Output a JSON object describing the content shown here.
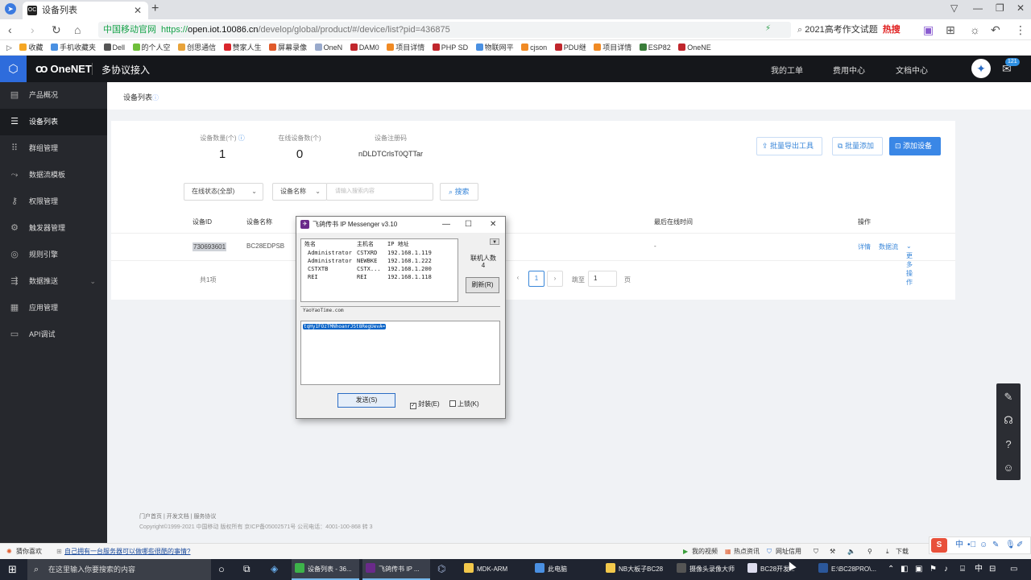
{
  "browser": {
    "tab_title": "设备列表",
    "favicon_text": "OC",
    "url_secure_label": "中国移动官网",
    "url_scheme": "https://",
    "url_host": "open.iot.10086.cn",
    "url_path": "/develop/global/product/#/device/list?pid=436875",
    "search_text": "2021高考作文试题",
    "search_hot": "热搜",
    "bookmarks": [
      "收藏",
      "手机收藏夹",
      "Dell",
      "的个人空",
      "创思通信",
      "赞家人生",
      "屏幕录像",
      "OneN",
      "DAM0",
      "项目详情",
      "PHP SD",
      "物联网平",
      "cjson",
      "PDU继",
      "项目详情",
      "ESP82",
      "OneNE"
    ]
  },
  "header": {
    "brand": "OneNET",
    "subtitle": "多协议接入",
    "menu": [
      "我的工单",
      "费用中心",
      "文档中心"
    ],
    "badge": "121"
  },
  "sidebar": {
    "items": [
      {
        "label": "产品概况",
        "icon": "chart-icon"
      },
      {
        "label": "设备列表",
        "icon": "list-icon"
      },
      {
        "label": "群组管理",
        "icon": "grid-icon"
      },
      {
        "label": "数据流模板",
        "icon": "flow-icon"
      },
      {
        "label": "权限管理",
        "icon": "key-icon"
      },
      {
        "label": "触发器管理",
        "icon": "trigger-icon"
      },
      {
        "label": "规则引擎",
        "icon": "engine-icon"
      },
      {
        "label": "数据推送",
        "icon": "push-icon"
      },
      {
        "label": "应用管理",
        "icon": "apps-icon"
      },
      {
        "label": "API调试",
        "icon": "api-icon"
      }
    ]
  },
  "page": {
    "breadcrumb": "设备列表",
    "stats": {
      "device_count_label": "设备数量(个)",
      "device_count": "1",
      "online_label": "在线设备数(个)",
      "online": "0",
      "reg_code_label": "设备注册码",
      "reg_code": "nDLDTCrlsT0QTTar"
    },
    "buttons": {
      "export": "批量导出工具",
      "batch_add": "批量添加",
      "add_device": "添加设备"
    },
    "filters": {
      "status": "在线状态(全部)",
      "field": "设备名称",
      "placeholder": "请输入搜索内容",
      "search": "搜索"
    },
    "table": {
      "headers": [
        "设备ID",
        "设备名称",
        "最后在线时间",
        "操作"
      ],
      "row": {
        "id": "730693601",
        "name": "BC28EDPSB",
        "last_online": "-",
        "actions": [
          "详情",
          "数据流",
          "更多操作"
        ]
      }
    },
    "pager": {
      "total": "共1项",
      "current": "1",
      "goto_label": "跳至",
      "goto_value": "1",
      "page_unit": "页"
    },
    "footer": {
      "links": [
        "门户首页",
        "开发文档",
        "服务协议"
      ],
      "copyright": "Copyright©1999-2021 中国移动 版权所有 京ICP备05002571号 公司电话：4001-100-868 转 3"
    }
  },
  "dialog": {
    "title": "飞鸽传书 IP Messenger v3.10",
    "columns": [
      "姓名",
      "主机名",
      "IP 地址"
    ],
    "users": [
      {
        "name": "Administrator",
        "host": "CSTXRD",
        "ip": "192.168.1.119"
      },
      {
        "name": "Administrator",
        "host": "NEWBKE",
        "ip": "192.168.1.222"
      },
      {
        "name": "CSTXTB",
        "host": "CSTX...",
        "ip": "192.168.1.200"
      },
      {
        "name": "REI",
        "host": "REI",
        "ip": "192.168.1.118"
      }
    ],
    "count_label": "联机人数",
    "count": "4",
    "refresh": "刷新(R)",
    "remote_host": "YaoYaoTime.com",
    "message": "tqHy1FOzTMNhoanrJSt8RegUevA=",
    "send": "发送(S)",
    "seal_label": "封装(E)",
    "seal_checked": "✓",
    "lock_label": "上锁(K)"
  },
  "statusbar": {
    "left_items": [
      "猜你喜欢"
    ],
    "news": "自己拥有一台服务器可以做哪些很酷的事情?",
    "right_items": [
      "我的视频",
      "热点资讯",
      "网址信用",
      "下载"
    ]
  },
  "taskbar": {
    "search_placeholder": "在这里输入你要搜索的内容",
    "apps": [
      "设备列表 - 36...",
      "飞鸽传书 IP ...",
      "MDK-ARM",
      "此电脑",
      "NB大板子BC28",
      "摄像头录像大师",
      "BC28开发...",
      "E:\\BC28PRO\\..."
    ],
    "ime": "中"
  }
}
